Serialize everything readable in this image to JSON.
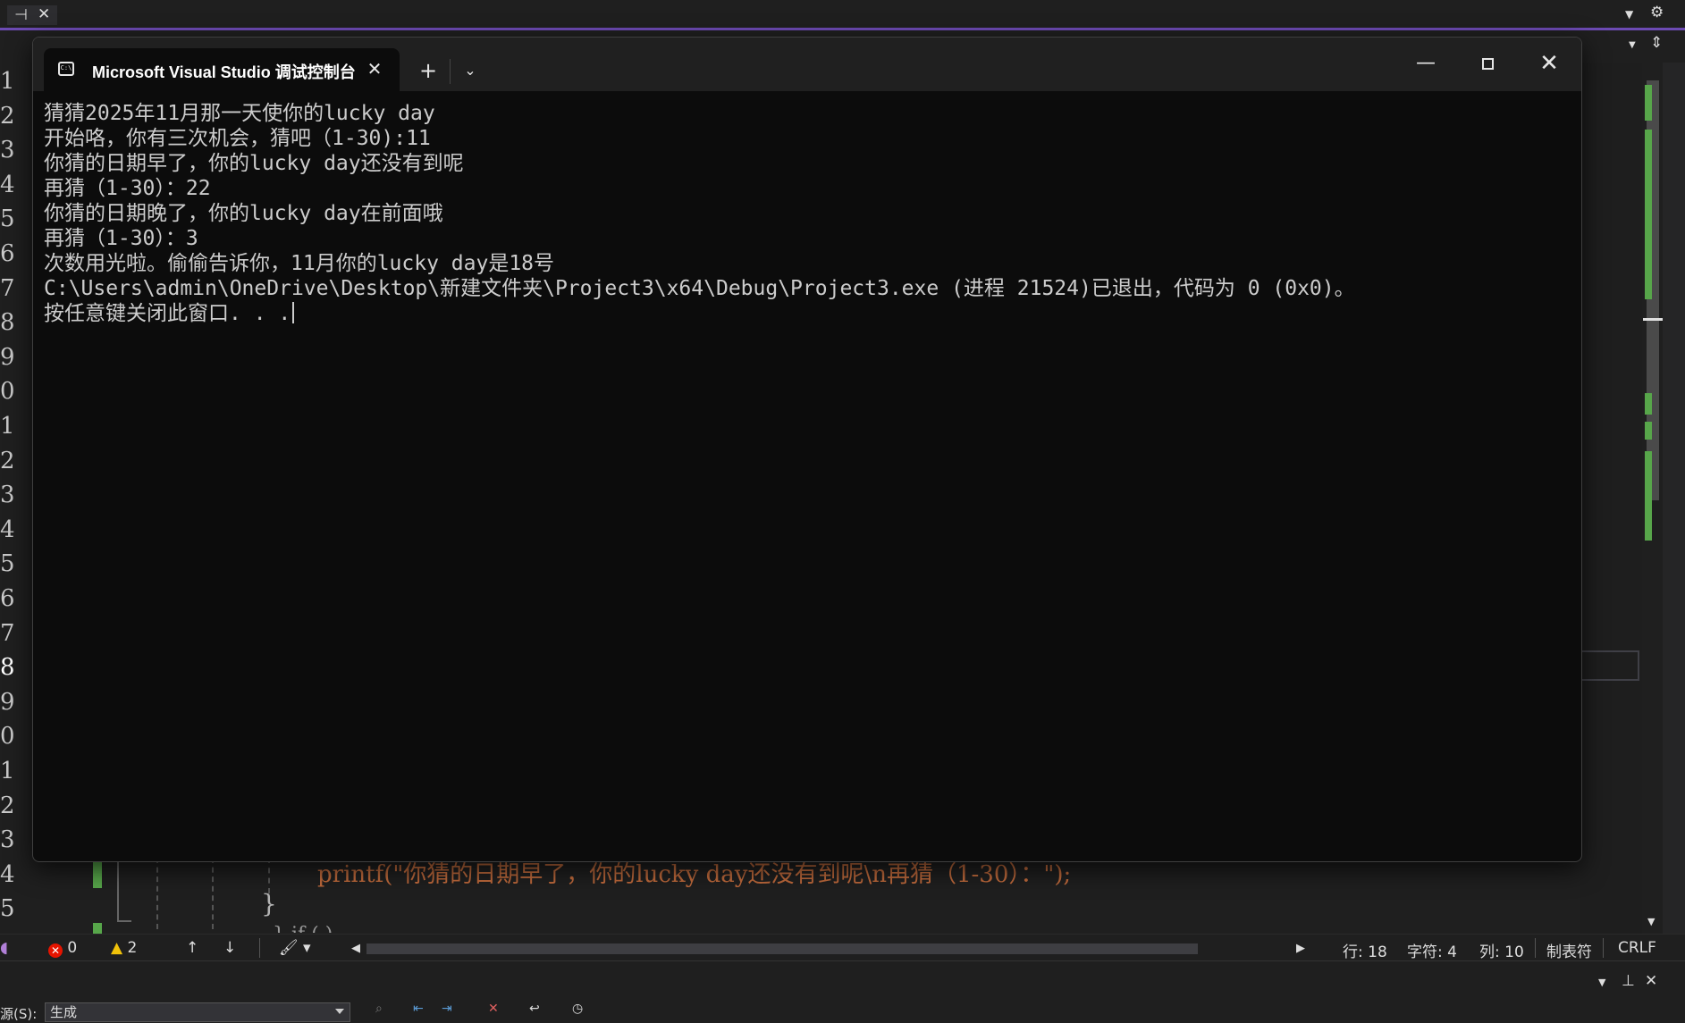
{
  "ide": {
    "gutter_numbers": [
      "1",
      "2",
      "3",
      "4",
      "5",
      "6",
      "7",
      "8",
      "9",
      "0",
      "1",
      "2",
      "3",
      "4",
      "5",
      "6",
      "7",
      "8",
      "9",
      "0",
      "1",
      "2",
      "3",
      "4",
      "5"
    ],
    "behind_code": "printf(\"你猜的日期早了，你的lucky day还没有到呢\\n再猜（1-30）：\");",
    "behind_brace": "}",
    "behind_if": "} if ( ) ",
    "status": {
      "errors": "0",
      "warnings": "2",
      "line": "行: 18",
      "char": "字符: 4",
      "col": "列: 10",
      "indent": "制表符",
      "eol": "CRLF"
    },
    "output": {
      "source_label": "源(S):",
      "source_value": "生成"
    }
  },
  "console": {
    "tab_title": "Microsoft Visual Studio 调试控制台",
    "tab_icon_text": "C:\\",
    "lines": [
      "猜猜2025年11月那一天使你的lucky day",
      "开始咯，你有三次机会，猜吧（1-30):11",
      "你猜的日期早了，你的lucky day还没有到呢",
      "再猜（1-30）：22",
      "你猜的日期晚了，你的lucky day在前面哦",
      "再猜（1-30）：3",
      "次数用光啦。偷偷告诉你，11月你的lucky day是18号",
      "C:\\Users\\admin\\OneDrive\\Desktop\\新建文件夹\\Project3\\x64\\Debug\\Project3.exe (进程 21524)已退出，代码为 0 (0x0)。",
      "按任意键关闭此窗口. . ."
    ]
  },
  "colors": {
    "console_bg": "#0c0c0c",
    "titlebar_bg": "#202020",
    "ide_bg": "#1f1f1f",
    "accent": "#6c4ab3",
    "change_green": "#57a64a"
  }
}
